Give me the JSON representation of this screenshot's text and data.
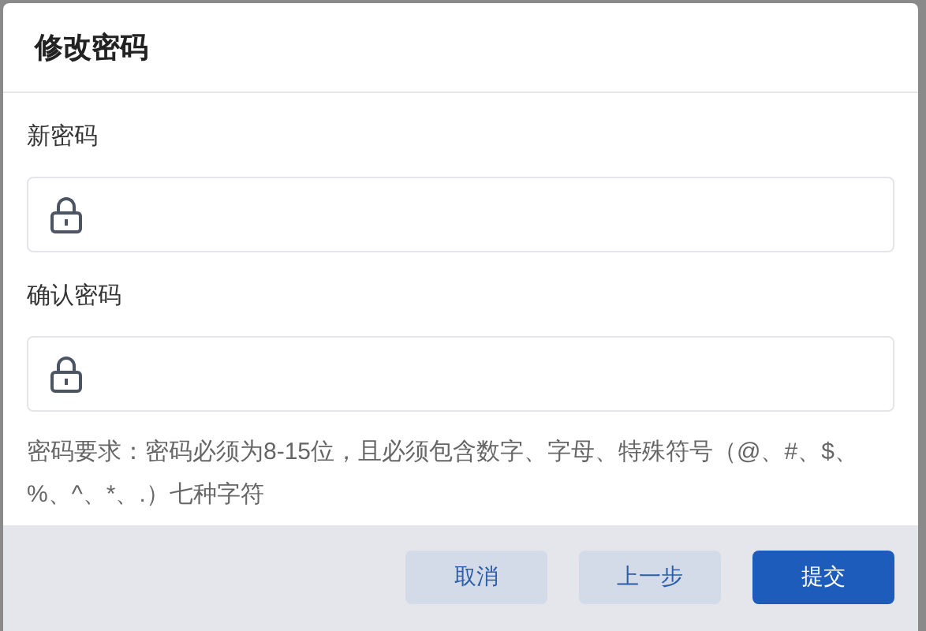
{
  "dialog": {
    "title": "修改密码"
  },
  "fields": [
    {
      "label": "新密码"
    },
    {
      "label": "确认密码"
    }
  ],
  "hint": "密码要求：密码必须为8-15位，且必须包含数字、字母、特殊符号（@、#、$、%、^、*、.）七种字符",
  "buttons": [
    {
      "label": "取消",
      "kind": "secondary"
    },
    {
      "label": "上一步",
      "kind": "secondary"
    },
    {
      "label": "提交",
      "kind": "primary"
    }
  ]
}
